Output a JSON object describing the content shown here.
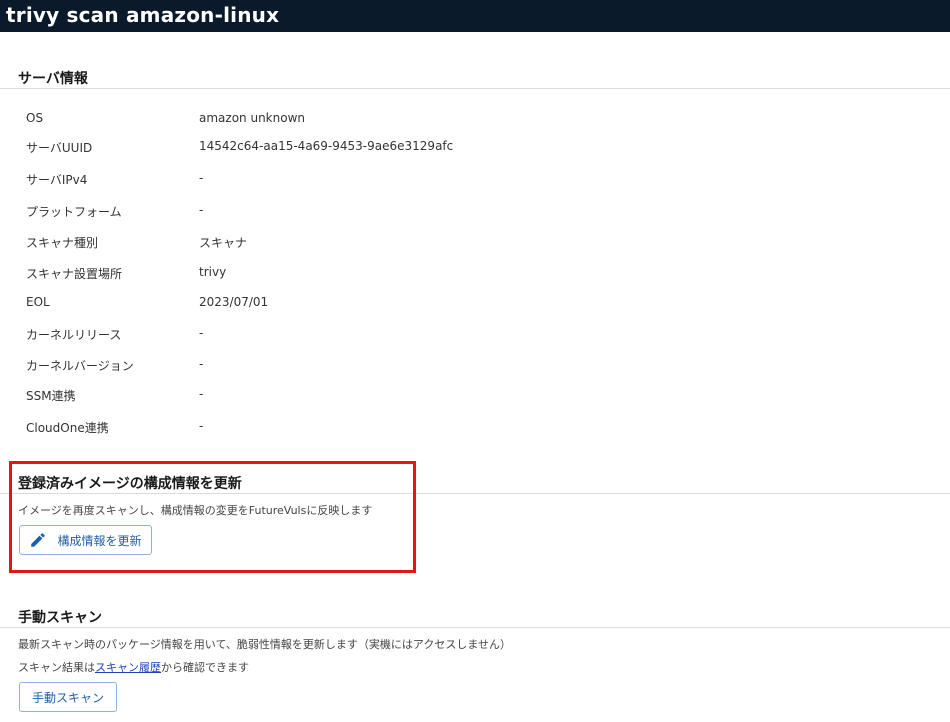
{
  "header": {
    "title": "trivy scan amazon-linux"
  },
  "server_info": {
    "heading": "サーバ情報",
    "rows": [
      {
        "label": "OS",
        "value": "amazon unknown"
      },
      {
        "label": "サーバUUID",
        "value": "14542c64-aa15-4a69-9453-9ae6e3129afc"
      },
      {
        "label": "サーバIPv4",
        "value": "-"
      },
      {
        "label": "プラットフォーム",
        "value": "-"
      },
      {
        "label": "スキャナ種別",
        "value": "スキャナ"
      },
      {
        "label": "スキャナ設置場所",
        "value": "trivy"
      },
      {
        "label": "EOL",
        "value": "2023/07/01"
      },
      {
        "label": "カーネルリリース",
        "value": "-"
      },
      {
        "label": "カーネルバージョン",
        "value": "-"
      },
      {
        "label": "SSM連携",
        "value": "-"
      },
      {
        "label": "CloudOne連携",
        "value": "-"
      }
    ]
  },
  "update_config": {
    "heading": "登録済みイメージの構成情報を更新",
    "description": "イメージを再度スキャンし、構成情報の変更をFutureVulsに反映します",
    "button_label": "構成情報を更新",
    "button_icon": "pencil-icon",
    "highlight_color": "#e3141b"
  },
  "manual_scan": {
    "heading": "手動スキャン",
    "description": "最新スキャン時のパッケージ情報を用いて、脆弱性情報を更新します（実機にはアクセスしません）",
    "history_prefix": "スキャン結果は",
    "history_link": "スキャン履歴",
    "history_suffix": "から確認できます",
    "button_label": "手動スキャン"
  },
  "colors": {
    "header_bg": "#0a1a2a",
    "accent": "#1f5fa8",
    "link": "#1d3fbf"
  }
}
